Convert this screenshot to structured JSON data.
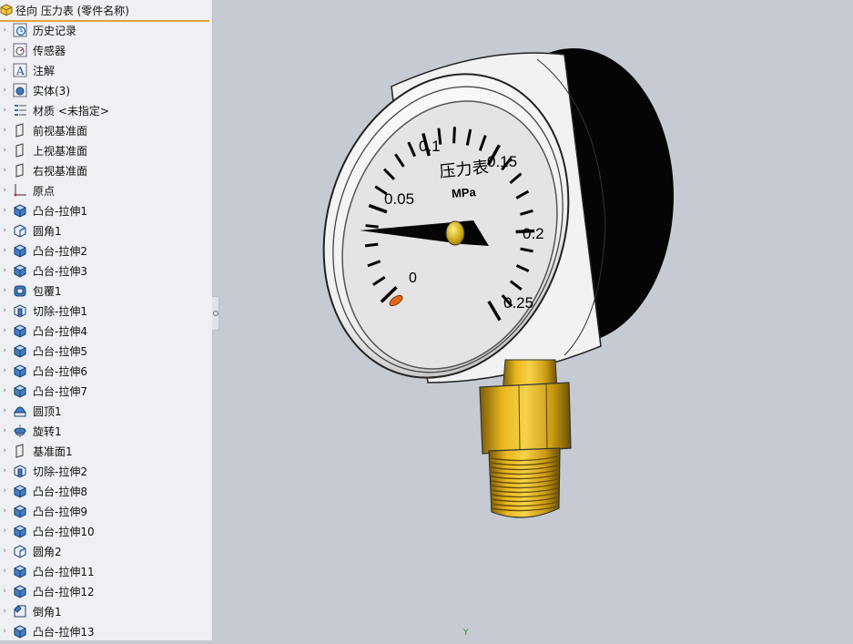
{
  "tree": {
    "title": "径向 压力表 (零件名称)",
    "items": [
      {
        "label": "历史记录",
        "icon": "history-icon"
      },
      {
        "label": "传感器",
        "icon": "sensor-icon"
      },
      {
        "label": "注解",
        "icon": "annotation-icon"
      },
      {
        "label": "实体(3)",
        "icon": "solid-bodies-icon"
      },
      {
        "label": "材质 <未指定>",
        "icon": "material-icon"
      },
      {
        "label": "前视基准面",
        "icon": "plane-icon"
      },
      {
        "label": "上视基准面",
        "icon": "plane-icon"
      },
      {
        "label": "右视基准面",
        "icon": "plane-icon"
      },
      {
        "label": "原点",
        "icon": "origin-icon"
      },
      {
        "label": "凸台-拉伸1",
        "icon": "boss-extrude-icon"
      },
      {
        "label": "圆角1",
        "icon": "fillet-icon"
      },
      {
        "label": "凸台-拉伸2",
        "icon": "boss-extrude-icon"
      },
      {
        "label": "凸台-拉伸3",
        "icon": "boss-extrude-icon"
      },
      {
        "label": "包覆1",
        "icon": "wrap-icon"
      },
      {
        "label": "切除-拉伸1",
        "icon": "cut-extrude-icon"
      },
      {
        "label": "凸台-拉伸4",
        "icon": "boss-extrude-icon"
      },
      {
        "label": "凸台-拉伸5",
        "icon": "boss-extrude-icon"
      },
      {
        "label": "凸台-拉伸6",
        "icon": "boss-extrude-icon"
      },
      {
        "label": "凸台-拉伸7",
        "icon": "boss-extrude-icon"
      },
      {
        "label": "圆顶1",
        "icon": "dome-icon"
      },
      {
        "label": "旋转1",
        "icon": "revolve-icon"
      },
      {
        "label": "基准面1",
        "icon": "plane-icon"
      },
      {
        "label": "切除-拉伸2",
        "icon": "cut-extrude-icon"
      },
      {
        "label": "凸台-拉伸8",
        "icon": "boss-extrude-icon"
      },
      {
        "label": "凸台-拉伸9",
        "icon": "boss-extrude-icon"
      },
      {
        "label": "凸台-拉伸10",
        "icon": "boss-extrude-icon"
      },
      {
        "label": "圆角2",
        "icon": "fillet-icon"
      },
      {
        "label": "凸台-拉伸11",
        "icon": "boss-extrude-icon"
      },
      {
        "label": "凸台-拉伸12",
        "icon": "boss-extrude-icon"
      },
      {
        "label": "倒角1",
        "icon": "chamfer-icon"
      },
      {
        "label": "凸台-拉伸13",
        "icon": "boss-extrude-icon"
      }
    ]
  },
  "gauge": {
    "title": "压力表",
    "unit": "MPa",
    "scale_labels": [
      "0",
      "0.05",
      "0.1",
      "0.15",
      "0.2",
      "0.25"
    ]
  },
  "viewport": {
    "background": "#c6cad2",
    "triad_label": "Y"
  }
}
